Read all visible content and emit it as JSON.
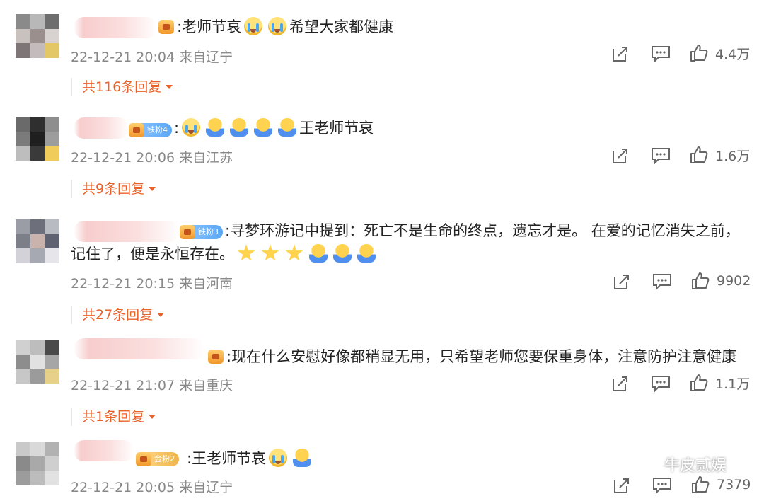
{
  "comments": [
    {
      "name_blurred": true,
      "badge": null,
      "prefix": ":",
      "text_parts": [
        "老师节哀",
        "希望大家都健康"
      ],
      "emojis": [
        "cry",
        "cry"
      ],
      "time": "22-12-21 20:04",
      "location": "来自辽宁",
      "likes": "4.4万",
      "replies": "共116条回复"
    },
    {
      "name_blurred": true,
      "badge": "铁粉4",
      "prefix": ":",
      "text_parts": [
        "王老师节哀"
      ],
      "emojis": [
        "cry",
        "hug",
        "hug",
        "hug",
        "hug"
      ],
      "time": "22-12-21 20:06",
      "location": "来自江苏",
      "likes": "1.6万",
      "replies": "共9条回复"
    },
    {
      "name_blurred": true,
      "badge": "铁粉3",
      "line1": ":寻梦环游记中提到：死亡不是生命的终点，遗忘才是。  在爱的记忆消失之前，",
      "line2": "记住了，便是永恒存在。",
      "emojis": [
        "star",
        "star",
        "star",
        "hug",
        "hug",
        "hug"
      ],
      "time": "22-12-21 20:15",
      "location": "来自河南",
      "likes": "9902",
      "replies": "共27条回复"
    },
    {
      "name_blurred": true,
      "badge": null,
      "text": ":现在什么安慰好像都稍显无用，只希望老师您要保重身体，注意防护注意健康",
      "time": "22-12-21 21:07",
      "location": "来自重庆",
      "likes": "1.1万",
      "replies": "共1条回复"
    },
    {
      "name_blurred": true,
      "badge": "金粉2",
      "text": ":王老师节哀",
      "emojis": [
        "cry",
        "hug"
      ],
      "time": "22-12-21 20:05",
      "location": "来自辽宁",
      "likes": "7379"
    }
  ],
  "icons": {
    "share": "share-icon",
    "comment": "comment-icon",
    "like": "thumbs-up-icon"
  },
  "watermark": "牛皮贰娱",
  "colors": {
    "reply_link": "#e8622a",
    "meta": "#888888"
  }
}
